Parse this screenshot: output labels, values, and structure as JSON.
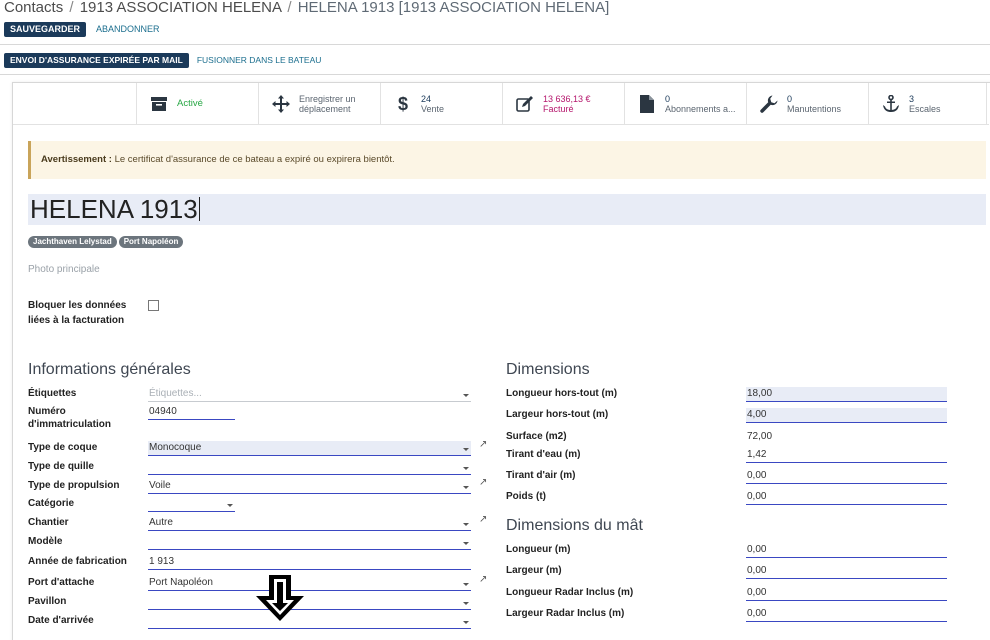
{
  "breadcrumb": {
    "root": "Contacts",
    "sep1": "/",
    "parent": "1913 ASSOCIATION HELENA",
    "sep2": "/",
    "current": "HELENA 1913 [1913 ASSOCIATION HELENA]"
  },
  "actions": {
    "save": "SAUVEGARDER",
    "discard": "ABANDONNER"
  },
  "statusbar": {
    "send_expired": "ENVOI D'ASSURANCE EXPIRÉE PAR MAIL",
    "merge": "FUSIONNER DANS LE BATEAU"
  },
  "smart_buttons": {
    "active": {
      "label": "Activé",
      "icon": "archive-icon"
    },
    "move": {
      "label1": "Enregistrer un",
      "label2": "déplacement",
      "icon": "arrows-move-icon"
    },
    "sale": {
      "value": "24",
      "label": "Vente",
      "icon": "dollar-icon"
    },
    "billed": {
      "value": "13 636,13 €",
      "label": "Facturé",
      "icon": "pencil-square-icon"
    },
    "subscriptions": {
      "value": "0",
      "label": "Abonnements a...",
      "icon": "file-icon"
    },
    "handling": {
      "value": "0",
      "label": "Manutentions",
      "icon": "wrench-icon"
    },
    "stops": {
      "value": "3",
      "label": "Escales",
      "icon": "anchor-icon"
    }
  },
  "alert": {
    "strong": "Avertissement :",
    "text": " Le certificat d'assurance de ce bateau a expiré ou expirera bientôt."
  },
  "record": {
    "name": "HELENA 1913",
    "tags": [
      "Jachthaven Lelystad",
      "Port Napoléon"
    ],
    "photo_label": "Photo principale",
    "lock_label": "Bloquer les données liées à la facturation",
    "lock_checked": false
  },
  "general": {
    "title": "Informations générales",
    "fields": [
      {
        "label": "Étiquettes",
        "value": "",
        "placeholder": "Étiquettes..."
      },
      {
        "label": "Numéro d'immatriculation",
        "value": "04940"
      },
      {
        "label": "Type de coque",
        "value": "Monocoque"
      },
      {
        "label": "Type de quille",
        "value": ""
      },
      {
        "label": "Type de propulsion",
        "value": "Voile"
      },
      {
        "label": "Catégorie",
        "value": ""
      },
      {
        "label": "Chantier",
        "value": "Autre"
      },
      {
        "label": "Modèle",
        "value": ""
      },
      {
        "label": "Année de fabrication",
        "value": "1 913"
      },
      {
        "label": "Port d'attache",
        "value": "Port Napoléon"
      },
      {
        "label": "Pavillon",
        "value": ""
      },
      {
        "label": "Date d'arrivée",
        "value": ""
      }
    ]
  },
  "dimensions": {
    "title": "Dimensions",
    "fields": [
      {
        "label": "Longueur hors-tout (m)",
        "value": "18,00"
      },
      {
        "label": "Largeur hors-tout (m)",
        "value": "4,00"
      },
      {
        "label": "Surface (m2)",
        "value": "72,00"
      },
      {
        "label": "Tirant d'eau (m)",
        "value": "1,42"
      },
      {
        "label": "Tirant d'air (m)",
        "value": "0,00"
      },
      {
        "label": "Poids (t)",
        "value": "0,00"
      }
    ]
  },
  "mast": {
    "title": "Dimensions du mât",
    "fields": [
      {
        "label": "Longueur (m)",
        "value": "0,00"
      },
      {
        "label": "Largeur (m)",
        "value": "0,00"
      },
      {
        "label": "Longueur Radar Inclus (m)",
        "value": "0,00"
      },
      {
        "label": "Largeur Radar Inclus (m)",
        "value": "0,00"
      }
    ]
  },
  "colors": {
    "primary": "#1b3a5a",
    "active_green": "#28a745",
    "billed_pink": "#b5166c",
    "warning_bg": "#fcf5e5",
    "field_underline": "#3a48c2"
  }
}
